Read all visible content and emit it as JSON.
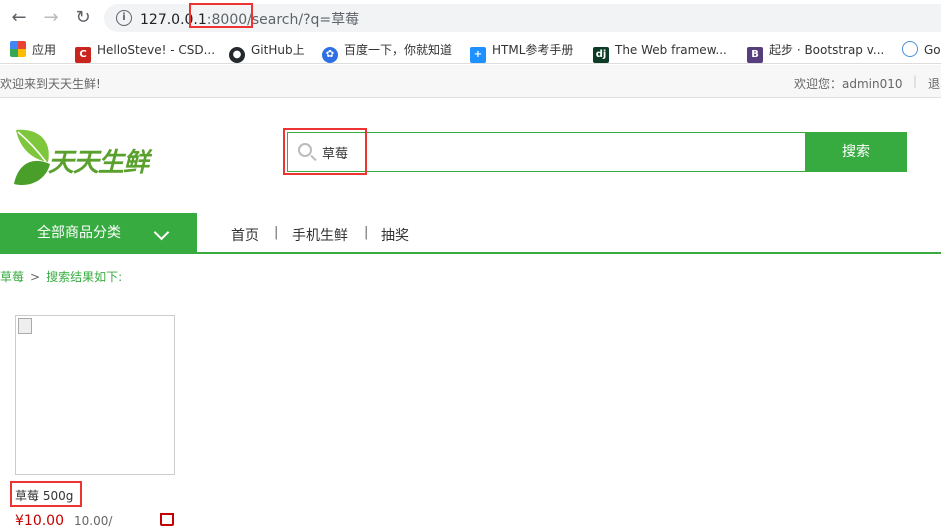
{
  "browser": {
    "url_host": "127.0.0.1",
    "url_rest": ":8000/search/?q=草莓",
    "bookmarks": [
      {
        "label": "应用"
      },
      {
        "label": "HelloSteve! - CSD..."
      },
      {
        "label": "GitHub上"
      },
      {
        "label": "百度一下，你就知道"
      },
      {
        "label": "HTML参考手册"
      },
      {
        "label": "The Web framew..."
      },
      {
        "label": "起步 · Bootstrap v..."
      },
      {
        "label": "Go"
      }
    ]
  },
  "topbar": {
    "welcome": "欢迎来到天天生鲜!",
    "user_info": "欢迎您：admin010",
    "separator": "|",
    "logout": "退"
  },
  "header": {
    "logo_text": "天天生鲜",
    "search_value": "草莓",
    "search_button": "搜索"
  },
  "nav": {
    "category_button": "全部商品分类",
    "items": [
      "首页",
      "手机生鲜",
      "抽奖"
    ],
    "separator": "|"
  },
  "breadcrumb": {
    "keyword": "草莓",
    "gt": ">",
    "text": "搜索结果如下:"
  },
  "goods": [
    {
      "name": "草莓 500g",
      "price": "¥10.00",
      "unit": "10.00/"
    }
  ],
  "colors": {
    "accent": "#37ab40",
    "price": "#c40000",
    "highlight": "#ee3333"
  }
}
